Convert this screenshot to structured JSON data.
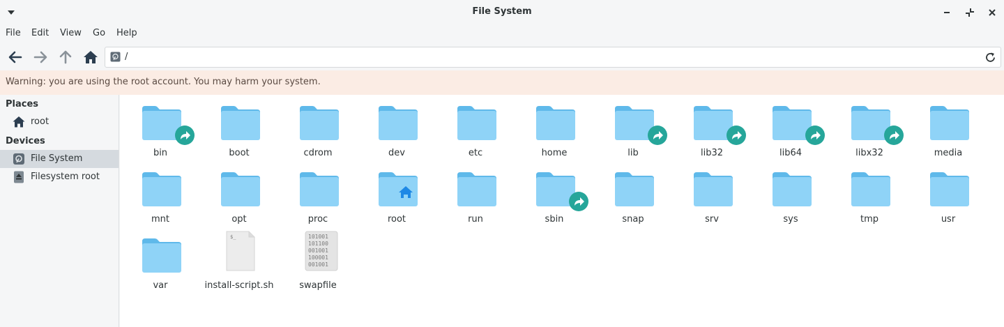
{
  "window": {
    "title": "File System",
    "controls": {
      "minimize": "minimize-icon",
      "maximize": "restore-icon",
      "close": "close-icon"
    }
  },
  "menu": [
    "File",
    "Edit",
    "View",
    "Go",
    "Help"
  ],
  "location": {
    "path": "/"
  },
  "warning": "Warning: you are using the root account. You may harm your system.",
  "sidebar": {
    "places_header": "Places",
    "places": [
      {
        "label": "root",
        "icon": "home-icon"
      }
    ],
    "devices_header": "Devices",
    "devices": [
      {
        "label": "File System",
        "icon": "drive-icon",
        "selected": true
      },
      {
        "label": "Filesystem root",
        "icon": "eject-drive-icon",
        "selected": false
      }
    ]
  },
  "files": [
    {
      "name": "bin",
      "kind": "folder",
      "link": true
    },
    {
      "name": "boot",
      "kind": "folder",
      "link": false
    },
    {
      "name": "cdrom",
      "kind": "folder",
      "link": false
    },
    {
      "name": "dev",
      "kind": "folder",
      "link": false
    },
    {
      "name": "etc",
      "kind": "folder",
      "link": false
    },
    {
      "name": "home",
      "kind": "folder",
      "link": false
    },
    {
      "name": "lib",
      "kind": "folder",
      "link": true
    },
    {
      "name": "lib32",
      "kind": "folder",
      "link": true
    },
    {
      "name": "lib64",
      "kind": "folder",
      "link": true
    },
    {
      "name": "libx32",
      "kind": "folder",
      "link": true
    },
    {
      "name": "media",
      "kind": "folder",
      "link": false
    },
    {
      "name": "mnt",
      "kind": "folder",
      "link": false
    },
    {
      "name": "opt",
      "kind": "folder",
      "link": false
    },
    {
      "name": "proc",
      "kind": "folder",
      "link": false
    },
    {
      "name": "root",
      "kind": "home-folder",
      "link": false
    },
    {
      "name": "run",
      "kind": "folder",
      "link": false
    },
    {
      "name": "sbin",
      "kind": "folder",
      "link": true
    },
    {
      "name": "snap",
      "kind": "folder",
      "link": false
    },
    {
      "name": "srv",
      "kind": "folder",
      "link": false
    },
    {
      "name": "sys",
      "kind": "folder",
      "link": false
    },
    {
      "name": "tmp",
      "kind": "folder",
      "link": false
    },
    {
      "name": "usr",
      "kind": "folder",
      "link": false
    },
    {
      "name": "var",
      "kind": "folder",
      "link": false
    },
    {
      "name": "install-script.sh",
      "kind": "script",
      "link": false,
      "glyph": "$_"
    },
    {
      "name": "swapfile",
      "kind": "binary",
      "link": false,
      "glyph": [
        "101001",
        "101100",
        "001001",
        "100001",
        "001001"
      ]
    }
  ],
  "colors": {
    "folder_body": "#8fd3f7",
    "folder_tab": "#5fb9ea",
    "link_badge": "#26a69a",
    "warning_bg": "#fbece4",
    "selected_bg": "#d5dadf",
    "icon_dark": "#2c3e50"
  }
}
